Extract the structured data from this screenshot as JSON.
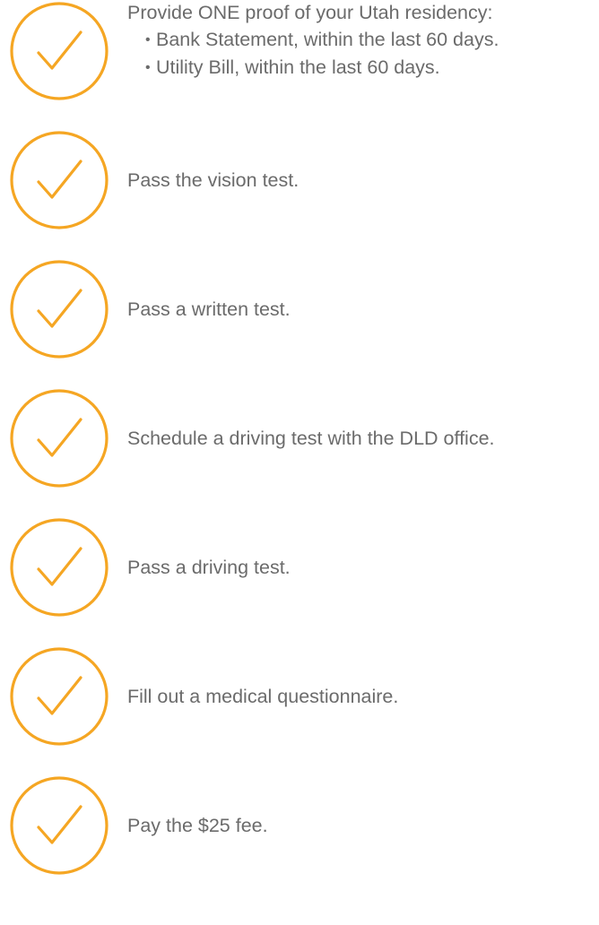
{
  "accent_color": "#f5a623",
  "checklist": {
    "items": [
      {
        "icon": "check-circle-icon",
        "text": "Provide ONE proof of your Utah residency:",
        "bullets": [
          "Bank Statement, within the last 60 days.",
          "Utility Bill, within the last 60 days."
        ]
      },
      {
        "icon": "check-circle-icon",
        "text": "Pass the vision test."
      },
      {
        "icon": "check-circle-icon",
        "text": "Pass a written test."
      },
      {
        "icon": "check-circle-icon",
        "text": "Schedule a driving test with the DLD office."
      },
      {
        "icon": "check-circle-icon",
        "text": "Pass a driving test."
      },
      {
        "icon": "check-circle-icon",
        "text": "Fill out a medical questionnaire."
      },
      {
        "icon": "check-circle-icon",
        "text": "Pay the $25 fee."
      }
    ]
  }
}
